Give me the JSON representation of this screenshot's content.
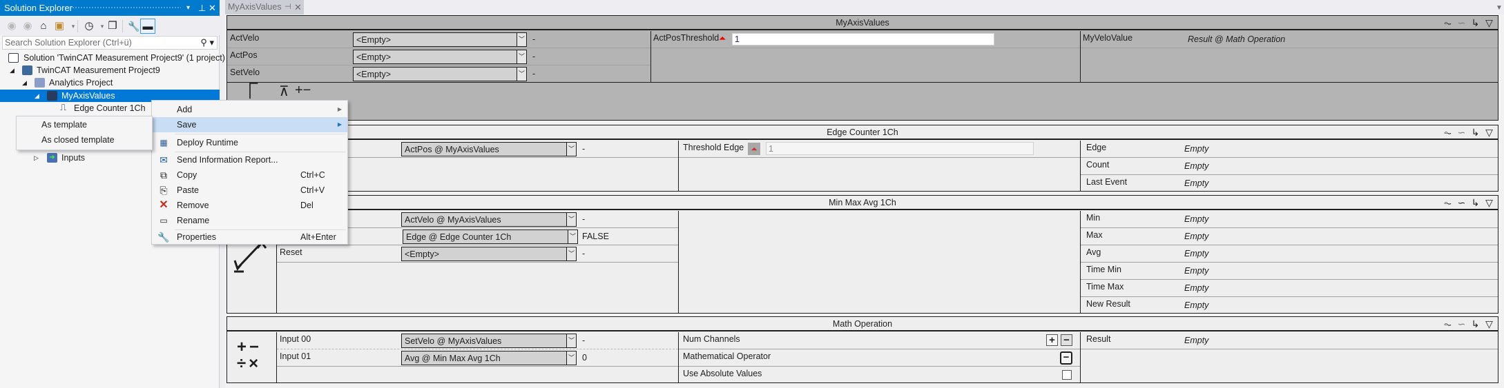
{
  "solution_explorer": {
    "title": "Solution Explorer",
    "title_controls": {
      "dropdown": "▾",
      "pin": "⊥",
      "close": "✕"
    },
    "toolbar": [
      {
        "name": "back-icon",
        "glyph": "◀",
        "disabled": true
      },
      {
        "name": "forward-icon",
        "glyph": "▶",
        "disabled": true
      },
      {
        "name": "home-icon",
        "glyph": "⌂",
        "disabled": false
      },
      {
        "name": "switch-views-icon",
        "glyph": "▤",
        "disabled": false
      },
      {
        "name": "pending-changes-icon",
        "glyph": "◷",
        "disabled": false
      },
      {
        "name": "collapse-all-icon",
        "glyph": "❐",
        "disabled": false
      },
      {
        "name": "properties-icon",
        "glyph": "🔧",
        "disabled": false
      },
      {
        "name": "preview-icon",
        "glyph": "▬",
        "disabled": false
      }
    ],
    "search_placeholder": "Search Solution Explorer (Ctrl+ü)",
    "tree": [
      {
        "label": "Solution 'TwinCAT Measurement Project9' (1 project)",
        "icon": "solution-icon",
        "expander": ""
      },
      {
        "label": "TwinCAT Measurement Project9",
        "icon": "measurement-project-icon",
        "expander": "◢"
      },
      {
        "label": "Analytics Project",
        "icon": "analytics-project-icon",
        "expander": "◢"
      },
      {
        "label": "MyAxisValues",
        "icon": "variables-icon",
        "expander": "◢",
        "selected": true
      },
      {
        "label": "Edge Counter 1Ch",
        "icon": "edge-counter-icon",
        "expander": ""
      },
      {
        "label": "Inputs",
        "icon": "inputs-icon",
        "expander": "▷"
      }
    ]
  },
  "context_menu": {
    "items": [
      {
        "label": "Add",
        "icon": "",
        "shortcut": "",
        "submenu": true
      },
      {
        "label": "Save",
        "icon": "",
        "shortcut": "",
        "submenu": true,
        "highlighted": true
      },
      {
        "label": "Deploy Runtime",
        "icon": "deploy-runtime-icon",
        "shortcut": ""
      },
      {
        "label": "Send Information Report...",
        "icon": "send-report-icon",
        "shortcut": ""
      },
      {
        "label": "Copy",
        "icon": "copy-icon",
        "shortcut": "Ctrl+C"
      },
      {
        "label": "Paste",
        "icon": "paste-icon",
        "shortcut": "Ctrl+V"
      },
      {
        "label": "Remove",
        "icon": "remove-icon",
        "shortcut": "Del"
      },
      {
        "label": "Rename",
        "icon": "rename-icon",
        "shortcut": ""
      },
      {
        "label": "Properties",
        "icon": "properties-icon",
        "shortcut": "Alt+Enter"
      }
    ],
    "save_submenu": [
      "As template",
      "As closed template"
    ]
  },
  "editor": {
    "tab": {
      "label": "MyAxisValues",
      "pin": "⊣",
      "close": "✕"
    },
    "blocks": [
      {
        "title": "MyAxisValues",
        "inputs": [
          {
            "label": "ActVelo",
            "source": "<Empty>",
            "value": "-"
          },
          {
            "label": "ActPos",
            "source": "<Empty>",
            "value": "-"
          },
          {
            "label": "SetVelo",
            "source": "<Empty>",
            "value": "-"
          }
        ],
        "config": [
          {
            "label": "ActPosThreshold",
            "value": "1"
          }
        ],
        "outputs": [
          {
            "label": "MyVeloValue",
            "value": "Result @ Math Operation"
          }
        ],
        "toolbox_icons": [
          "edge-counter-tool-icon",
          "min-max-avg-tool-icon",
          "math-operation-tool-icon"
        ]
      },
      {
        "title": "Edge Counter 1Ch",
        "inputs": [
          {
            "label": "",
            "source": "ActPos @ MyAxisValues",
            "value": "-"
          }
        ],
        "config": [
          {
            "label": "Threshold Edge",
            "value": "1"
          }
        ],
        "outputs": [
          {
            "label": "Edge",
            "value": "Empty"
          },
          {
            "label": "Count",
            "value": "Empty"
          },
          {
            "label": "Last Event",
            "value": "Empty"
          }
        ]
      },
      {
        "title": "Min Max Avg 1Ch",
        "inputs": [
          {
            "label": "",
            "source": "ActVelo @ MyAxisValues",
            "value": "-"
          },
          {
            "label": "",
            "source": "Edge @ Edge Counter 1Ch",
            "value": "FALSE"
          },
          {
            "label": "Reset",
            "source": "<Empty>",
            "value": "-"
          }
        ],
        "outputs": [
          {
            "label": "Min",
            "value": "Empty"
          },
          {
            "label": "Max",
            "value": "Empty"
          },
          {
            "label": "Avg",
            "value": "Empty"
          },
          {
            "label": "Time Min",
            "value": "Empty"
          },
          {
            "label": "Time Max",
            "value": "Empty"
          },
          {
            "label": "New Result",
            "value": "Empty"
          }
        ]
      },
      {
        "title": "Math Operation",
        "inputs": [
          {
            "label": "Input 00",
            "source": "SetVelo @ MyAxisValues",
            "value": "-"
          },
          {
            "label": "Input 01",
            "source": "Avg @ Min Max Avg 1Ch",
            "value": "0"
          }
        ],
        "config": [
          {
            "label": "Num Channels"
          },
          {
            "label": "Mathematical Operator",
            "value": "−"
          },
          {
            "label": "Use Absolute Values",
            "checked": false
          }
        ],
        "outputs": [
          {
            "label": "Result",
            "value": "Empty"
          }
        ]
      }
    ],
    "block_header_icons": [
      "scope-icon",
      "link-icon",
      "reset-icon",
      "collapse-icon"
    ]
  }
}
